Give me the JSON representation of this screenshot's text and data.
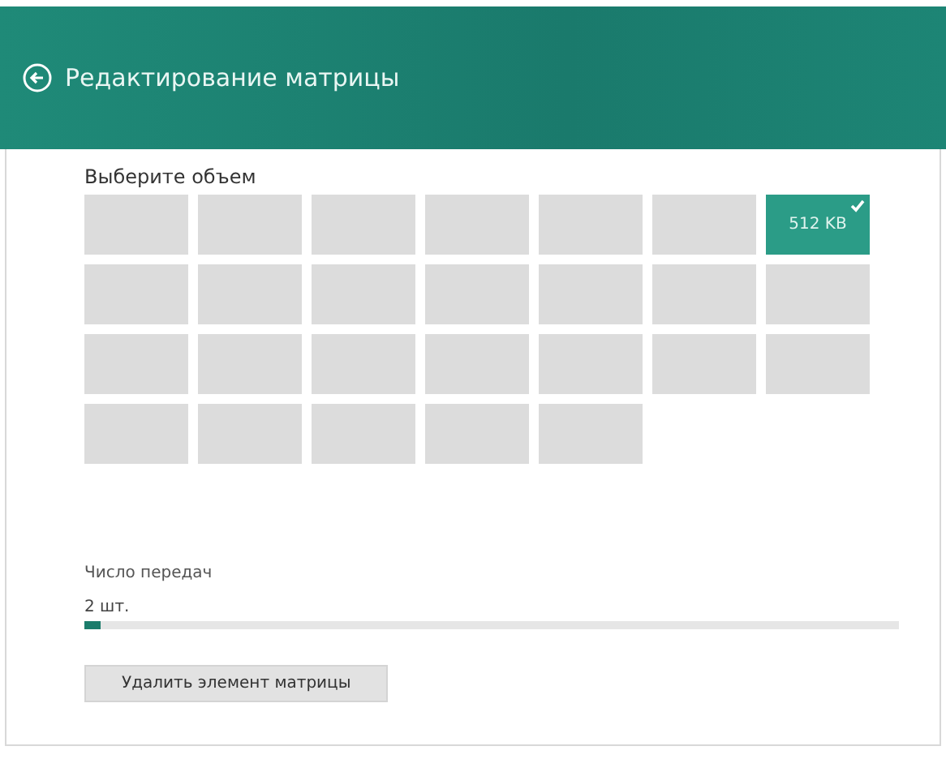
{
  "header": {
    "title": "Редактирование матрицы"
  },
  "size_picker": {
    "label": "Выберите объем",
    "tiles": [
      {
        "selected": false
      },
      {
        "selected": false
      },
      {
        "selected": false
      },
      {
        "selected": false
      },
      {
        "selected": false
      },
      {
        "selected": false
      },
      {
        "label": "512 KB",
        "selected": true
      },
      {
        "selected": false
      },
      {
        "selected": false
      },
      {
        "selected": false
      },
      {
        "selected": false
      },
      {
        "selected": false
      },
      {
        "selected": false
      },
      {
        "selected": false
      },
      {
        "selected": false
      },
      {
        "selected": false
      },
      {
        "selected": false
      },
      {
        "selected": false
      },
      {
        "selected": false
      },
      {
        "selected": false
      },
      {
        "selected": false
      },
      {
        "selected": false
      },
      {
        "selected": false
      },
      {
        "selected": false
      },
      {
        "selected": false
      },
      {
        "selected": false
      }
    ]
  },
  "transfers": {
    "label": "Число передач",
    "reading": "2 шт.",
    "level": 0.02
  },
  "buttons": [
    "Удалить элемент матрицы"
  ]
}
